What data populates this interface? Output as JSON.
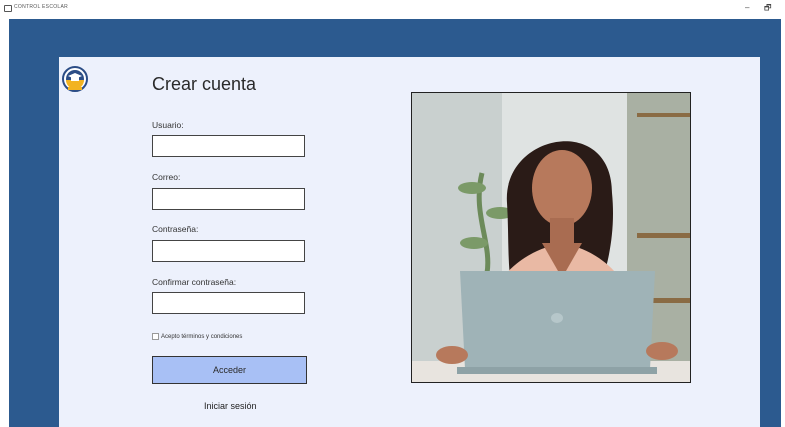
{
  "window": {
    "title": "CONTROL ESCOLAR",
    "minimize_glyph": "–",
    "maximize_glyph": "🗗"
  },
  "form": {
    "heading": "Crear cuenta",
    "fields": [
      {
        "label": "Usuario:",
        "value": "",
        "placeholder": ""
      },
      {
        "label": "Correo:",
        "value": "",
        "placeholder": ""
      },
      {
        "label": "Contraseña:",
        "value": "",
        "placeholder": ""
      },
      {
        "label": "Confirmar contraseña:",
        "value": "",
        "placeholder": ""
      }
    ],
    "terms_label": "Acepto términos y condiciones",
    "terms_checked": false,
    "submit_label": "Acceder",
    "login_link": "Iniciar sesión"
  },
  "icons": {
    "logo": "graduation-cap-logo-icon",
    "window_icon": "app-window-icon"
  },
  "colors": {
    "background_blue": "#2c5a8f",
    "card": "#edf1fc",
    "button": "#a8c0f5"
  }
}
